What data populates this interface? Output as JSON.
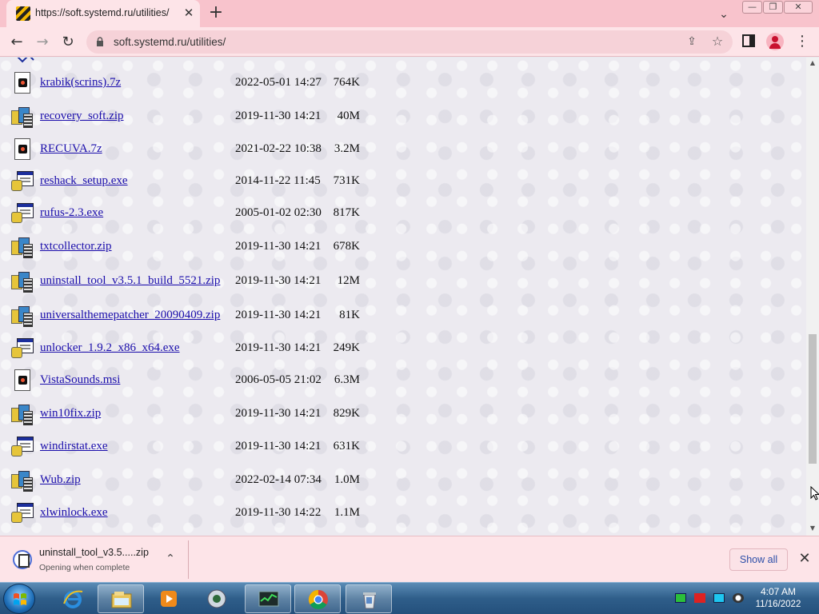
{
  "browser": {
    "tab_title": "https://soft.systemd.ru/utilities/",
    "tab_close": "✕",
    "new_tab": "+",
    "tab_search": "⌄",
    "url": "soft.systemd.ru/utilities/",
    "window_controls": {
      "minimize": "—",
      "restore": "❐",
      "close": "✕"
    },
    "nav": {
      "back": "←",
      "forward": "→",
      "reload": "↻"
    },
    "menu": "⋮"
  },
  "files": [
    {
      "name": "krabik(scrins).7z",
      "date": "2022-05-01 14:27",
      "size": "764K",
      "icon": "generic-file-icon"
    },
    {
      "name": "recovery_soft.zip",
      "date": "2019-11-30 14:21",
      "size": "40M",
      "icon": "archive-icon"
    },
    {
      "name": "RECUVA.7z",
      "date": "2021-02-22 10:38",
      "size": "3.2M",
      "icon": "generic-file-icon"
    },
    {
      "name": "reshack_setup.exe",
      "date": "2014-11-22 11:45",
      "size": "731K",
      "icon": "executable-icon"
    },
    {
      "name": "rufus-2.3.exe",
      "date": "2005-01-02 02:30",
      "size": "817K",
      "icon": "executable-icon"
    },
    {
      "name": "txtcollector.zip",
      "date": "2019-11-30 14:21",
      "size": "678K",
      "icon": "archive-icon"
    },
    {
      "name": "uninstall_tool_v3.5.1_build_5521.zip",
      "date": "2019-11-30 14:21",
      "size": "12M",
      "icon": "archive-icon"
    },
    {
      "name": "universalthemepatcher_20090409.zip",
      "date": "2019-11-30 14:21",
      "size": "81K",
      "icon": "archive-icon"
    },
    {
      "name": "unlocker_1.9.2_x86_x64.exe",
      "date": "2019-11-30 14:21",
      "size": "249K",
      "icon": "executable-icon"
    },
    {
      "name": "VistaSounds.msi",
      "date": "2006-05-05 21:02",
      "size": "6.3M",
      "icon": "generic-file-icon"
    },
    {
      "name": "win10fix.zip",
      "date": "2019-11-30 14:21",
      "size": "829K",
      "icon": "archive-icon"
    },
    {
      "name": "windirstat.exe",
      "date": "2019-11-30 14:21",
      "size": "631K",
      "icon": "executable-icon"
    },
    {
      "name": "Wub.zip",
      "date": "2022-02-14 07:34",
      "size": "1.0M",
      "icon": "archive-icon"
    },
    {
      "name": "xlwinlock.exe",
      "date": "2019-11-30 14:22",
      "size": "1.1M",
      "icon": "executable-icon"
    }
  ],
  "download": {
    "filename": "uninstall_tool_v3.5.....zip",
    "status": "Opening when complete",
    "chevron": "⌃",
    "show_all": "Show all",
    "close": "✕"
  },
  "scrollbar": {
    "up": "▲",
    "down": "▼"
  },
  "taskbar": {
    "time": "4:07 AM",
    "date": "11/16/2022",
    "pinned": [
      "internet-explorer-icon",
      "file-explorer-icon",
      "media-player-icon",
      "media-center-icon",
      "task-manager-icon",
      "chrome-icon",
      "recycle-bin-icon"
    ]
  },
  "colors": {
    "tab_strip": "#f8c3cc",
    "toolbar": "#fde4e8",
    "link": "#1a0dab",
    "taskbar": "#2f5e8a"
  }
}
